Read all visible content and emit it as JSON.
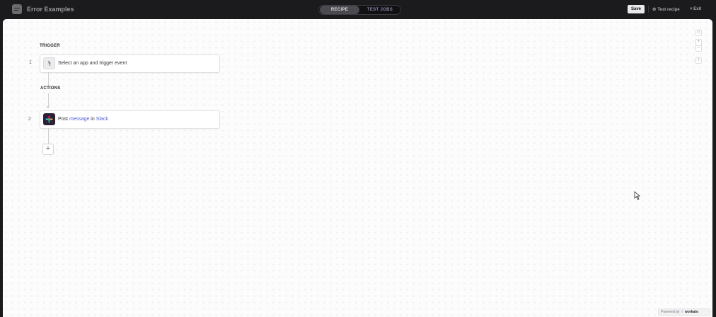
{
  "header": {
    "title": "Error Examples",
    "tabs": [
      {
        "label": "RECIPE",
        "active": true
      },
      {
        "label": "TEST JOBS",
        "active": false
      }
    ],
    "save_label": "Save",
    "test_recipe_label": "Test recipe",
    "exit_label": "Exit"
  },
  "canvas": {
    "trigger_label": "TRIGGER",
    "actions_label": "ACTIONS",
    "steps": [
      {
        "number": "1",
        "text": "Select an app and trigger event",
        "icon": "trigger-bolt-icon"
      },
      {
        "number": "2",
        "text_prefix": "Post ",
        "text_highlight1": "message",
        "text_middle": " in ",
        "text_highlight2": "Slack",
        "icon": "slack-icon"
      }
    ],
    "add_step_label": "+"
  },
  "zoom_controls": [
    "fit-icon",
    "zoom-in-icon",
    "zoom-out-icon",
    "recenter-icon"
  ],
  "footer": {
    "powered_by": "Powered by",
    "brand": "workato"
  },
  "colors": {
    "top_bar": "#1b1b1d",
    "canvas": "#fcfcfc",
    "accent_link": "#4d5ad7",
    "slack_bg": "#2c1f37"
  }
}
